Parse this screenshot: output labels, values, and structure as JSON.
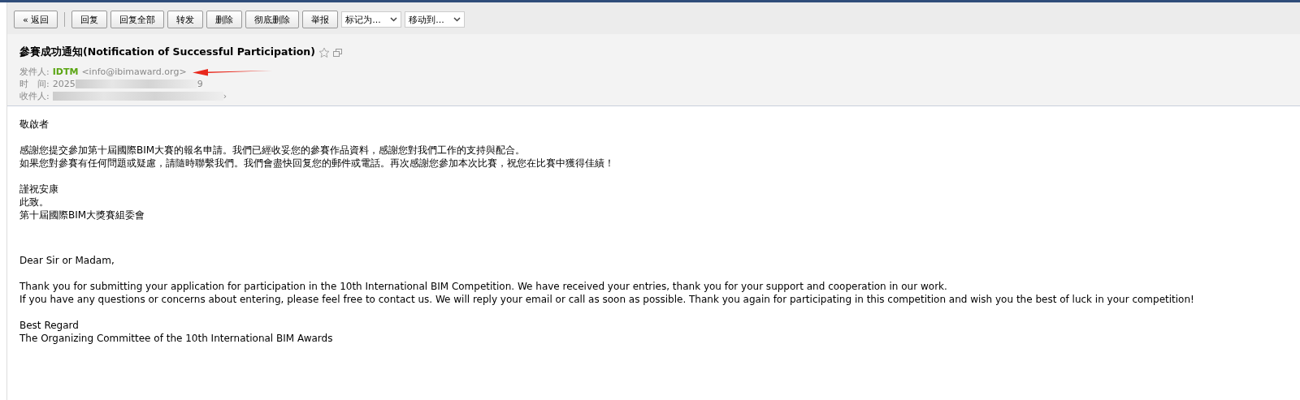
{
  "toolbar": {
    "back": "« 返回",
    "buttons": [
      "回复",
      "回复全部",
      "转发",
      "删除",
      "彻底删除",
      "举报"
    ],
    "dropdowns": [
      "标记为...",
      "移动到..."
    ]
  },
  "header": {
    "subject": "參賽成功通知(Notification of Successful Participation)",
    "starred": false,
    "from_label": "发件人:",
    "from_name": "IDTM",
    "from_address": "<info@ibimaward.org>",
    "time_label": "时　间:",
    "time_start": "2025",
    "time_end": "9",
    "to_label": "收件人:",
    "to_end": "›"
  },
  "body": {
    "paragraphs": [
      [
        "敬啟者"
      ],
      [
        "感謝您提交參加第十屆國際BIM大賽的報名申請。我們已經收妥您的參賽作品資料，感謝您對我們工作的支持與配合。",
        "如果您對參賽有任何問題或疑慮，請隨時聯繫我們。我們會盡快回复您的郵件或電話。再次感謝您參加本次比賽，祝您在比賽中獲得佳績！"
      ],
      [
        "謹祝安康",
        "此致。",
        "第十屆國際BIM大獎賽組委會"
      ],
      [
        "Dear Sir or Madam,"
      ],
      [
        "Thank you for submitting your application for participation in the 10th International BIM Competition. We have received your entries, thank you for your support and cooperation in our work.",
        "If you have any questions or concerns about entering, please feel free to contact us. We will reply your email or call as soon as possible. Thank you again for participating in this competition and wish you the best of luck in your competition!"
      ],
      [
        "Best Regard",
        "The Organizing Committee of the 10th International BIM Awards"
      ]
    ]
  }
}
